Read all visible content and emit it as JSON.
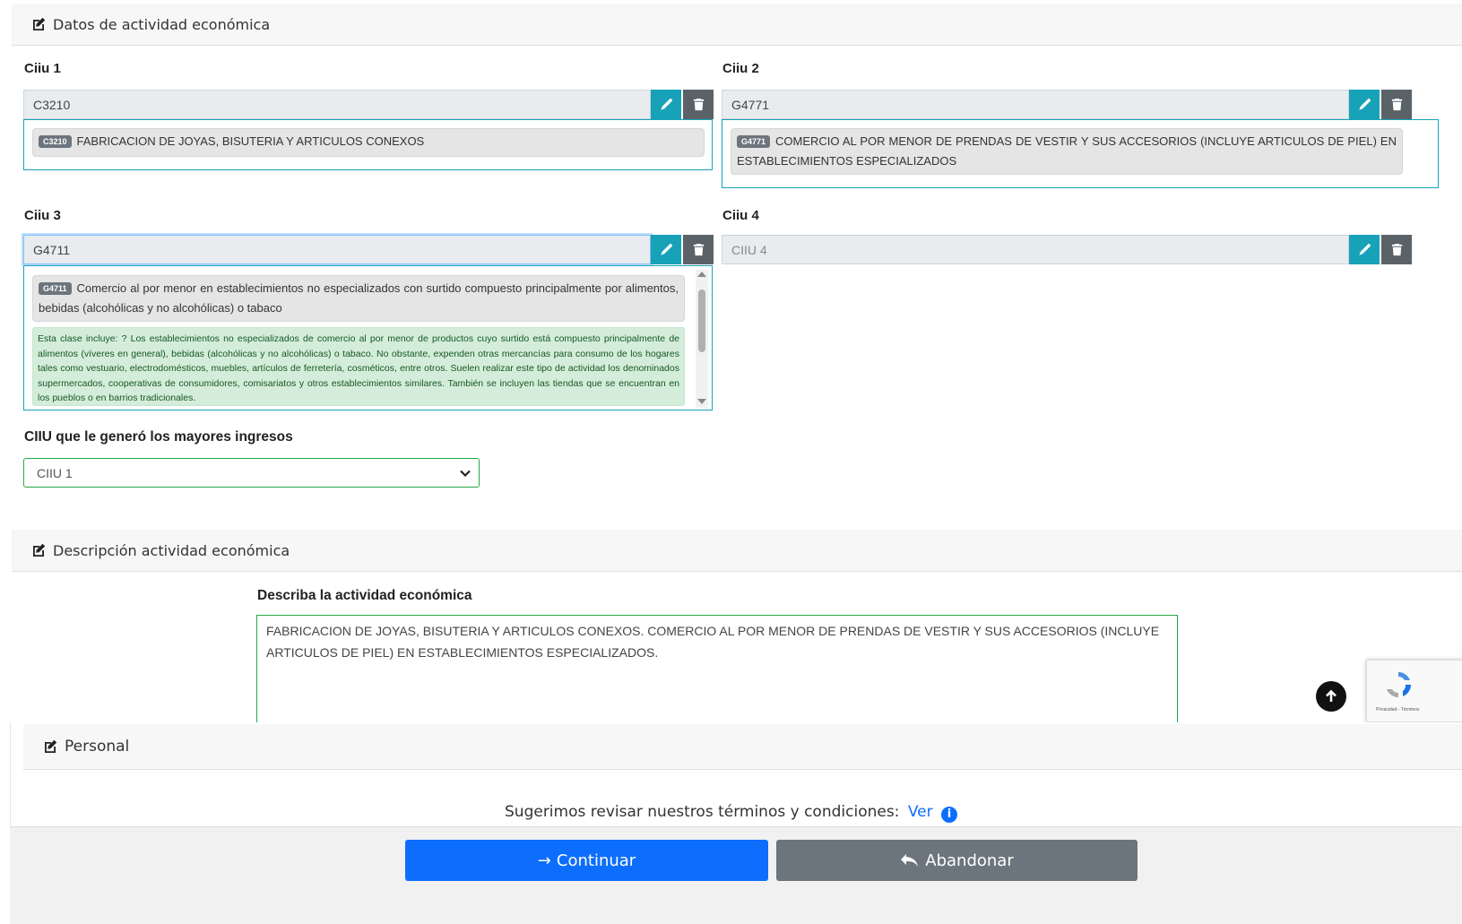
{
  "sections": {
    "economic": "Datos de actividad económica",
    "description": "Descripción actividad económica",
    "personal": "Personal"
  },
  "ciiu1": {
    "label": "Ciiu 1",
    "value": "C3210",
    "result_code": "C3210",
    "result_text": "FABRICACION DE JOYAS, BISUTERIA Y ARTICULOS CONEXOS"
  },
  "ciiu2": {
    "label": "Ciiu 2",
    "value": "G4771",
    "result_code": "G4771",
    "result_text": "COMERCIO AL POR MENOR DE PRENDAS DE VESTIR Y SUS ACCESORIOS (INCLUYE ARTICULOS DE PIEL) EN ESTABLECIMIENTOS ESPECIALIZADOS"
  },
  "ciiu3": {
    "label": "Ciiu 3",
    "value": "G4711",
    "result_code": "G4711",
    "result_text": "Comercio al por menor en establecimientos no especializados con surtido compuesto principalmente por alimentos, bebidas (alcohólicas y no alcohólicas) o tabaco",
    "result_detail": "Esta clase incluye: ? Los establecimientos no especializados de comercio al por menor de productos cuyo surtido está compuesto principalmente de alimentos (víveres en general), bebidas (alcohólicas y no alcohólicas) o tabaco. No obstante, expenden otras mercancías para consumo de los hogares tales como vestuario, electrodomésticos, muebles, artículos de ferretería, cosméticos, entre otros. Suelen realizar este tipo de actividad los denominados supermercados, cooperativas de consumidores, comisariatos y otros establecimientos similares. También se incluyen las tiendas que se encuentran en los pueblos o en barrios tradicionales."
  },
  "ciiu4": {
    "label": "Ciiu 4",
    "placeholder": "CIIU 4"
  },
  "main_income": {
    "label": "CIIU que le generó los mayores ingresos",
    "selected": "CIIU 1"
  },
  "activity": {
    "label": "Describa la actividad económica",
    "value": "FABRICACION DE JOYAS, BISUTERIA Y ARTICULOS CONEXOS. COMERCIO AL POR MENOR DE PRENDAS DE VESTIR Y SUS ACCESORIOS (INCLUYE ARTICULOS DE PIEL) EN ESTABLECIMIENTOS ESPECIALIZADOS."
  },
  "terms": {
    "text": "Sugerimos revisar nuestros términos y condiciones:",
    "link": "Ver"
  },
  "buttons": {
    "continue": "Continuar",
    "abandon": "Abandonar"
  },
  "recaptcha": {
    "text": "Privacidad - Términos"
  },
  "colors": {
    "info": "#17a2b8",
    "primary": "#0d6efd",
    "secondary": "#6c757d",
    "success": "#28a745"
  }
}
